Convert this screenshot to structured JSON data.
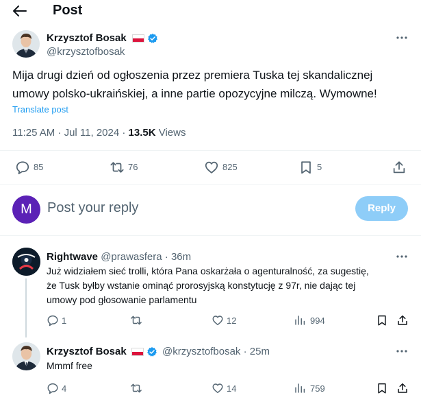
{
  "header": {
    "title": "Post"
  },
  "post": {
    "author_name": "Krzysztof Bosak",
    "author_handle": "@krzysztofbosak",
    "text_line1": "Mija drugi dzień od ogłoszenia przez premiera Tuska tej skandalicznej",
    "text_line2": "umowy polsko-ukraińskiej, a inne partie opozycyjne milczą. Wymowne!",
    "translate_label": "Translate post",
    "timestamp": "11:25 AM · Jul 11, 2024 · ",
    "views_count": "13.5K",
    "views_label": " Views",
    "replies": "85",
    "reposts": "76",
    "likes": "825",
    "bookmarks": "5"
  },
  "composer": {
    "avatar_letter": "M",
    "placeholder": "Post your reply",
    "reply_button": "Reply"
  },
  "replies": [
    {
      "author_name": "Rightwave",
      "meta": "@prawasfera · 36m",
      "text_line1": "Już widziałem sieć trolli, która Pana oskarżała o agenturalność, za sugestię,",
      "text_line2": "że Tusk byłby wstanie ominąć prorosyjską konstytucję z 97r, nie dając tej",
      "text_line3": "umowy pod głosowanie parlamentu",
      "replies": "1",
      "reposts": "",
      "likes": "12",
      "views": "994"
    },
    {
      "author_name": "Krzysztof Bosak",
      "meta": "@krzysztofbosak · 25m",
      "text_line1": "Mmmf free",
      "replies": "4",
      "reposts": "",
      "likes": "14",
      "views": "759"
    }
  ],
  "colors": {
    "accent": "#1d9bf0",
    "reply_button_disabled": "#8ecdf8",
    "composer_avatar": "#5b21b6",
    "flag_red": "#dc143c"
  }
}
